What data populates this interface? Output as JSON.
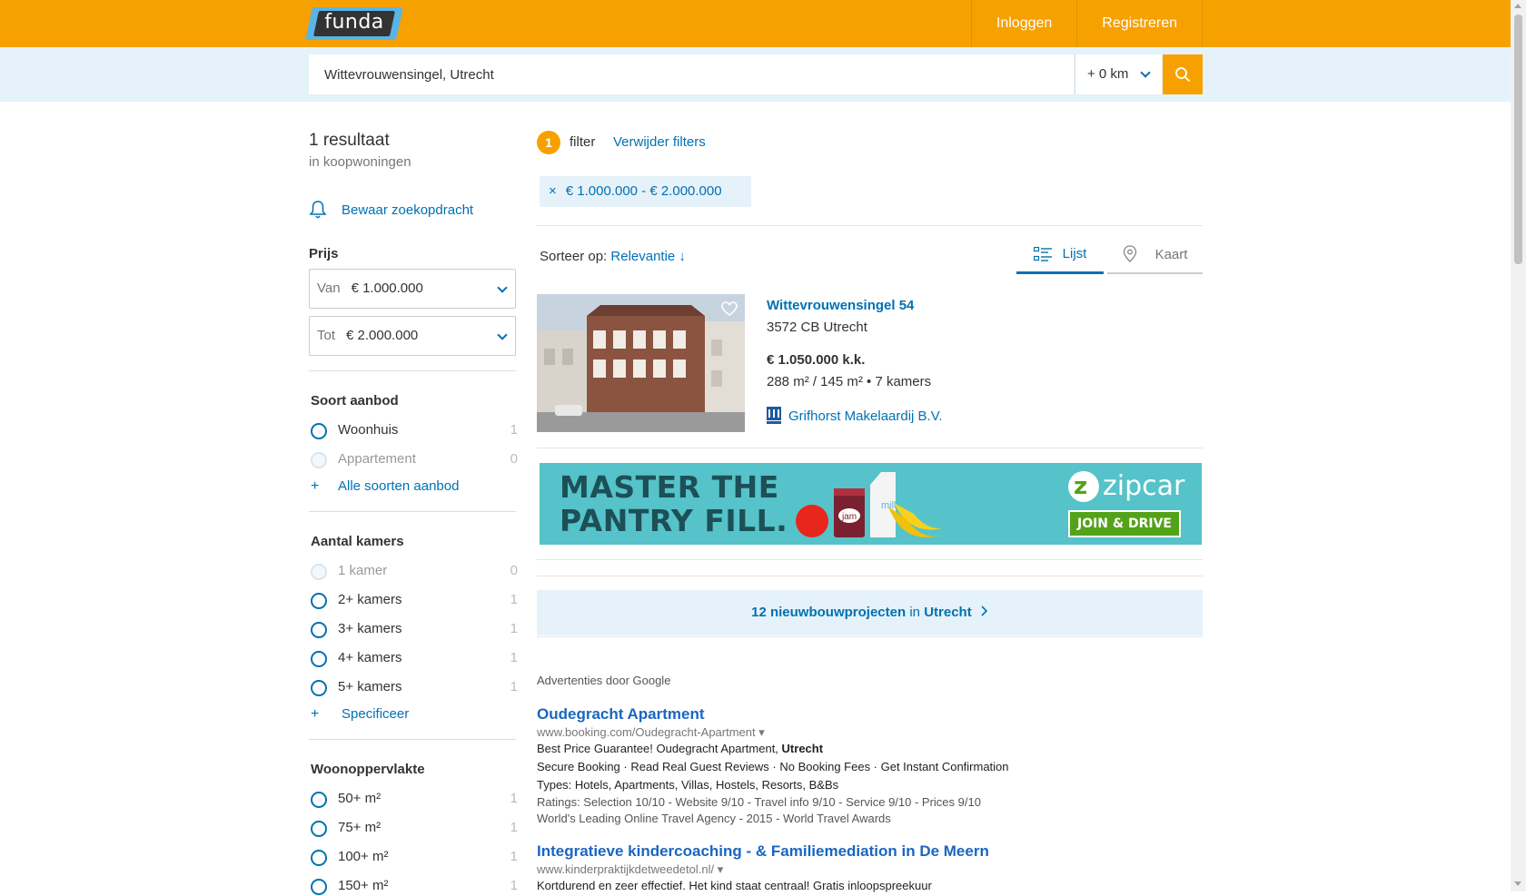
{
  "header": {
    "logo_text": "funda",
    "login_label": "Inloggen",
    "register_label": "Registreren"
  },
  "search": {
    "value": "Wittevrouwensingel, Utrecht",
    "radius": "+ 0 km"
  },
  "sidebar": {
    "result_count": "1 resultaat",
    "result_sub": "in koopwoningen",
    "save_search": "Bewaar zoekopdracht",
    "price": {
      "title": "Prijs",
      "from_label": "Van",
      "from_value": "€ 1.000.000",
      "to_label": "Tot",
      "to_value": "€ 2.000.000"
    },
    "offer_type": {
      "title": "Soort aanbod",
      "options": [
        {
          "label": "Woonhuis",
          "count": "1"
        },
        {
          "label": "Appartement",
          "count": "0"
        }
      ],
      "more": "Alle soorten aanbod"
    },
    "rooms": {
      "title": "Aantal kamers",
      "options": [
        {
          "label": "1 kamer",
          "count": "0"
        },
        {
          "label": "2+ kamers",
          "count": "1"
        },
        {
          "label": "3+ kamers",
          "count": "1"
        },
        {
          "label": "4+ kamers",
          "count": "1"
        },
        {
          "label": "5+ kamers",
          "count": "1"
        }
      ],
      "more": "Specificeer"
    },
    "area": {
      "title": "Woonoppervlakte",
      "options": [
        {
          "label": "50+ m²",
          "count": "1"
        },
        {
          "label": "75+ m²",
          "count": "1"
        },
        {
          "label": "100+ m²",
          "count": "1"
        },
        {
          "label": "150+ m²",
          "count": "1"
        }
      ]
    }
  },
  "filters": {
    "count": "1",
    "label": "filter",
    "remove": "Verwijder filters",
    "chip": "€ 1.000.000 - € 2.000.000"
  },
  "sort": {
    "label": "Sorteer op:",
    "value": "Relevantie ↓"
  },
  "views": {
    "list": "Lijst",
    "map": "Kaart"
  },
  "listing": {
    "street": "Wittevrouwensingel 54",
    "zip_city": "3572 CB Utrecht",
    "price": "€ 1.050.000 k.k.",
    "specs": "288 m² / 145 m² • 7 kamers",
    "agent": "Grifhorst Makelaardij B.V."
  },
  "ad_banner": {
    "line1": "MASTER THE",
    "line2": "PANTRY FILL.",
    "brand": "zipcar",
    "cta": "JOIN & DRIVE",
    "jar_label": "jam",
    "milk_label": "milk"
  },
  "newbuild": {
    "count_text": "12 nieuwbouwprojecten",
    "in": "in",
    "city": "Utrecht"
  },
  "google_ads": {
    "label": "Advertenties door Google",
    "ads": [
      {
        "title": "Oudegracht Apartment",
        "url": "www.booking.com/Oudegracht-Apartment ▾",
        "line1_a": "Best Price Guarantee! Oudegracht Apartment, ",
        "line1_b": "Utrecht",
        "line2": "Secure Booking · Read Real Guest Reviews · No Booking Fees · Get Instant Confirmation",
        "line3": "Types: Hotels, Apartments, Villas, Hostels, Resorts, B&Bs",
        "line4": "Ratings: Selection 10/10 - Website 9/10 - Travel info 9/10 - Service 9/10 - Prices 9/10",
        "line5": "World's Leading Online Travel Agency - 2015 - World Travel Awards"
      },
      {
        "title": "Integratieve kindercoaching - & Familiemediation in De Meern",
        "url": "www.kinderpraktijkdetweedetol.nl/ ▾",
        "line1": "Kortdurend en zeer effectief. Het kind staat centraal! Gratis inloopspreekuur"
      }
    ]
  },
  "colors": {
    "brand_orange": "#f7a100",
    "link_blue": "#0071b3",
    "light_blue_bg": "#e6f2f9"
  }
}
